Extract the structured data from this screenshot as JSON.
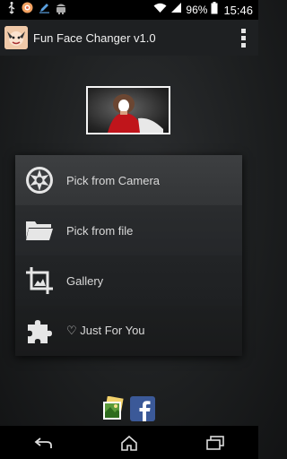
{
  "status_bar": {
    "battery_percent": "96%",
    "time": "15:46",
    "left_icons": [
      "usb-icon",
      "notification-app-icon",
      "edit-icon",
      "android-icon"
    ],
    "right_icons": [
      "wifi-icon",
      "signal-icon",
      "battery-icon"
    ]
  },
  "action_bar": {
    "title": "Fun Face Changer v1.0",
    "menu_icon": "overflow-menu-icon"
  },
  "preview": {
    "icon": "face-template-photo"
  },
  "menu": {
    "items": [
      {
        "label": "Pick from Camera",
        "icon": "camera-aperture-icon"
      },
      {
        "label": "Pick from file",
        "icon": "folder-icon"
      },
      {
        "label": "Gallery",
        "icon": "crop-icon"
      },
      {
        "label": "♡ Just For You",
        "icon": "puzzle-icon"
      }
    ]
  },
  "bottom_apps": [
    {
      "icon": "photo-gallery-app-icon"
    },
    {
      "icon": "facebook-icon"
    }
  ],
  "nav_bar": {
    "buttons": [
      "back-icon",
      "home-icon",
      "recent-apps-icon"
    ]
  },
  "colors": {
    "statusbar": "#000000",
    "actionbar": "#1e2022",
    "menu_highlight": "#3d3f41",
    "facebook_blue": "#3b5998"
  }
}
